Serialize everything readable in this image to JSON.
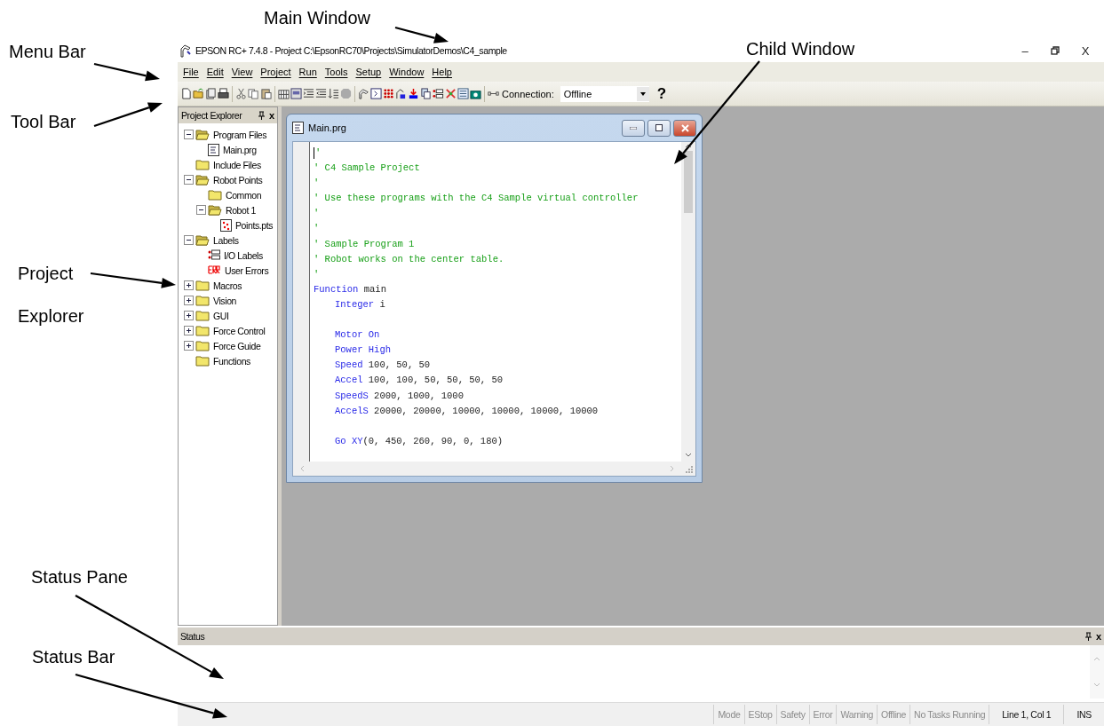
{
  "annotations": [
    {
      "label": "Menu Bar"
    },
    {
      "label": "Tool Bar"
    },
    {
      "label": "Project Explorer"
    },
    {
      "label": "Main Window"
    },
    {
      "label": "Child Window"
    },
    {
      "label": "Status Pane"
    },
    {
      "label": "Status Bar"
    }
  ],
  "window": {
    "title": "EPSON RC+ 7.4.8 - Project C:\\EpsonRC70\\Projects\\SimulatorDemos\\C4_sample",
    "minimize": "–",
    "close": "X"
  },
  "menu": [
    {
      "label": "File"
    },
    {
      "label": "Edit"
    },
    {
      "label": "View"
    },
    {
      "label": "Project"
    },
    {
      "label": "Run"
    },
    {
      "label": "Tools"
    },
    {
      "label": "Setup"
    },
    {
      "label": "Window"
    },
    {
      "label": "Help"
    }
  ],
  "toolbar": {
    "connection_label": "Connection:",
    "connection_value": "Offline",
    "help": "?"
  },
  "project_explorer": {
    "title": "Project Explorer",
    "close": "x",
    "tree": [
      {
        "label": "Program Files",
        "kind": "folder-open",
        "expanded": true,
        "children": [
          {
            "label": "Main.prg",
            "kind": "program"
          }
        ]
      },
      {
        "label": "Include Files",
        "kind": "folder"
      },
      {
        "label": "Robot Points",
        "kind": "folder-open",
        "expanded": true,
        "children": [
          {
            "label": "Common",
            "kind": "folder"
          },
          {
            "label": "Robot 1",
            "kind": "folder-open",
            "expanded": true,
            "children": [
              {
                "label": "Points.pts",
                "kind": "points"
              }
            ]
          }
        ]
      },
      {
        "label": "Labels",
        "kind": "folder-open",
        "expanded": true,
        "children": [
          {
            "label": "I/O Labels",
            "kind": "io"
          },
          {
            "label": "User Errors",
            "kind": "error"
          }
        ]
      },
      {
        "label": "Macros",
        "kind": "folder",
        "expanded": false
      },
      {
        "label": "Vision",
        "kind": "folder",
        "expanded": false
      },
      {
        "label": "GUI",
        "kind": "folder",
        "expanded": false
      },
      {
        "label": "Force Control",
        "kind": "folder",
        "expanded": false
      },
      {
        "label": "Force Guide",
        "kind": "folder",
        "expanded": false
      },
      {
        "label": "Functions",
        "kind": "folder"
      }
    ]
  },
  "editor": {
    "title": "Main.prg",
    "lines": [
      {
        "kind": "text",
        "tokens": [
          {
            "kind": "comment",
            "text": "'"
          }
        ]
      },
      {
        "kind": "text",
        "tokens": [
          {
            "kind": "comment",
            "text": "' C4 Sample Project"
          }
        ]
      },
      {
        "kind": "text",
        "tokens": [
          {
            "kind": "comment",
            "text": "'"
          }
        ]
      },
      {
        "kind": "text",
        "tokens": [
          {
            "kind": "comment",
            "text": "' Use these programs with the C4 Sample virtual controller"
          }
        ]
      },
      {
        "kind": "text",
        "tokens": [
          {
            "kind": "comment",
            "text": "'"
          }
        ]
      },
      {
        "kind": "text",
        "tokens": [
          {
            "kind": "comment",
            "text": "'"
          }
        ]
      },
      {
        "kind": "text",
        "tokens": [
          {
            "kind": "comment",
            "text": "' Sample Program 1"
          }
        ]
      },
      {
        "kind": "text",
        "tokens": [
          {
            "kind": "comment",
            "text": "' Robot works on the center table."
          }
        ]
      },
      {
        "kind": "text",
        "tokens": [
          {
            "kind": "comment",
            "text": "'"
          }
        ]
      },
      {
        "kind": "text",
        "tokens": [
          {
            "kind": "keyword",
            "text": "Function"
          },
          {
            "kind": "plain",
            "text": " main"
          }
        ],
        "children": [
          {
            "kind": "text",
            "tokens": [
              {
                "kind": "keyword",
                "text": "Integer"
              },
              {
                "kind": "plain",
                "text": " i"
              }
            ]
          },
          {
            "kind": "blank"
          },
          {
            "kind": "text",
            "tokens": [
              {
                "kind": "keyword",
                "text": "Motor On"
              }
            ]
          },
          {
            "kind": "text",
            "tokens": [
              {
                "kind": "keyword",
                "text": "Power High"
              }
            ]
          },
          {
            "kind": "text",
            "tokens": [
              {
                "kind": "keyword",
                "text": "Speed"
              },
              {
                "kind": "plain",
                "text": " 100, 50, 50"
              }
            ]
          },
          {
            "kind": "text",
            "tokens": [
              {
                "kind": "keyword",
                "text": "Accel"
              },
              {
                "kind": "plain",
                "text": " 100, 100, 50, 50, 50, 50"
              }
            ]
          },
          {
            "kind": "text",
            "tokens": [
              {
                "kind": "keyword",
                "text": "SpeedS"
              },
              {
                "kind": "plain",
                "text": " 2000, 1000, 1000"
              }
            ]
          },
          {
            "kind": "text",
            "tokens": [
              {
                "kind": "keyword",
                "text": "AccelS"
              },
              {
                "kind": "plain",
                "text": " 20000, 20000, 10000, 10000, 10000, 10000"
              }
            ]
          },
          {
            "kind": "blank"
          },
          {
            "kind": "text",
            "tokens": [
              {
                "kind": "keyword",
                "text": "Go XY"
              },
              {
                "kind": "plain",
                "text": "(0, 450, 260, 90, 0, 180)"
              }
            ]
          }
        ]
      }
    ]
  },
  "status_pane": {
    "title": "Status",
    "close": "x"
  },
  "status_bar": [
    {
      "label": "Mode",
      "disabled": true
    },
    {
      "label": "EStop",
      "disabled": true
    },
    {
      "label": "Safety",
      "disabled": true
    },
    {
      "label": "Error",
      "disabled": true
    },
    {
      "label": "Warning",
      "disabled": true
    },
    {
      "label": "Offline",
      "disabled": true
    },
    {
      "label": "No Tasks Running",
      "disabled": true
    },
    {
      "label": "Line 1, Col 1",
      "disabled": false
    },
    {
      "label": "INS",
      "disabled": false
    }
  ]
}
